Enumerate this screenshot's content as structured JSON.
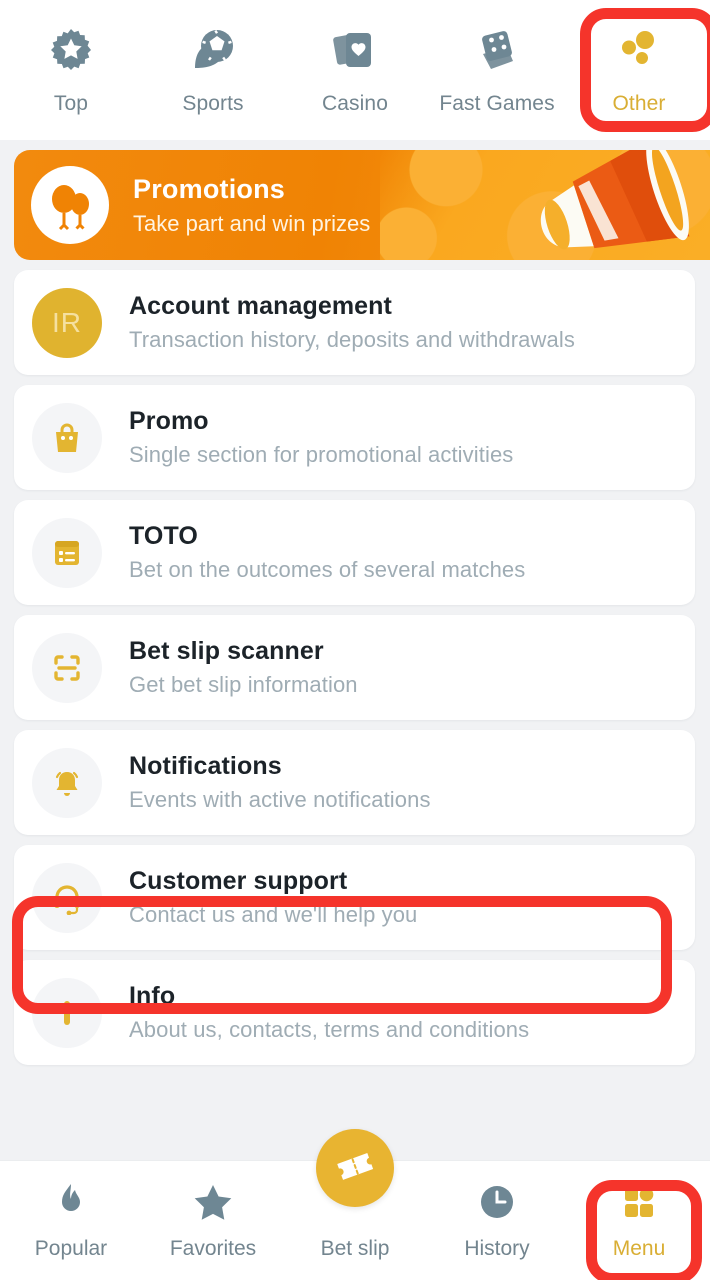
{
  "top_nav": {
    "items": [
      {
        "label": "Top",
        "icon": "badge-star-icon",
        "active": false
      },
      {
        "label": "Sports",
        "icon": "soccer-ball-icon",
        "active": false
      },
      {
        "label": "Casino",
        "icon": "playing-cards-icon",
        "active": false
      },
      {
        "label": "Fast Games",
        "icon": "dice-cards-icon",
        "active": false
      },
      {
        "label": "Other",
        "icon": "three-dots-icon",
        "active": true
      }
    ]
  },
  "banner": {
    "title": "Promotions",
    "subtitle": "Take part and win prizes",
    "icon": "balloons-icon",
    "art": "megaphone-illustration"
  },
  "menu_items": [
    {
      "title": "Account management",
      "subtitle": "Transaction history, deposits and withdrawals",
      "icon": "user-avatar",
      "avatar_initials": "IR"
    },
    {
      "title": "Promo",
      "subtitle": "Single section for promotional activities",
      "icon": "shopping-bag-icon"
    },
    {
      "title": "TOTO",
      "subtitle": "Bet on the outcomes of several matches",
      "icon": "list-form-icon"
    },
    {
      "title": "Bet slip scanner",
      "subtitle": "Get bet slip information",
      "icon": "qr-scanner-icon"
    },
    {
      "title": "Notifications",
      "subtitle": "Events with active notifications",
      "icon": "bell-icon"
    },
    {
      "title": "Customer support",
      "subtitle": "Contact us and we'll help you",
      "icon": "headset-icon"
    },
    {
      "title": "Info",
      "subtitle": "About us, contacts, terms and conditions",
      "icon": "info-icon"
    }
  ],
  "bottom_nav": {
    "items": [
      {
        "label": "Popular",
        "icon": "flame-icon",
        "accent": false
      },
      {
        "label": "Favorites",
        "icon": "star-icon",
        "accent": false
      },
      {
        "label": "Bet slip",
        "icon": "ticket-icon",
        "accent": false
      },
      {
        "label": "History",
        "icon": "clock-icon",
        "accent": false
      },
      {
        "label": "Menu",
        "icon": "grid-icon",
        "accent": true
      }
    ]
  },
  "colors": {
    "accent_gold": "#E0B32F",
    "banner_orange": "#F08304",
    "icon_gray": "#73858F",
    "annotation_red": "#F5342B",
    "title_text": "#1C2329",
    "subtitle_text": "#9FACB4",
    "page_background": "#F1F2F4"
  }
}
